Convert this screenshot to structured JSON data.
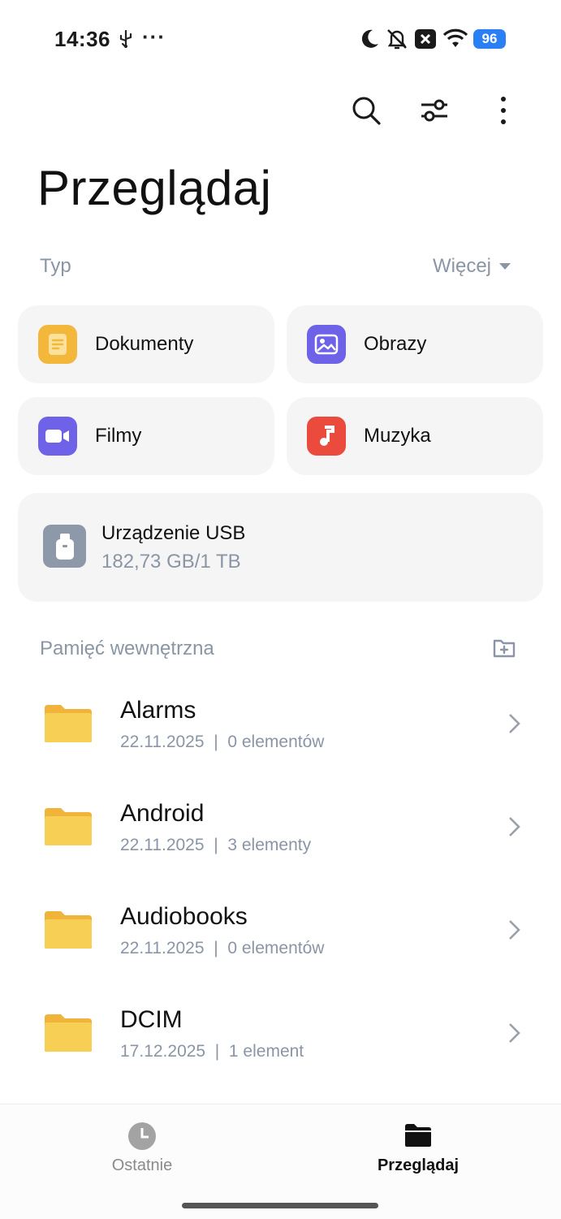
{
  "status_bar": {
    "time": "14:36",
    "dots": "···",
    "battery": "96",
    "icons": [
      "usb-icon",
      "moon-icon",
      "mute-icon",
      "close-notification-icon",
      "wifi-icon",
      "battery-icon"
    ]
  },
  "toolbar": {
    "icons": [
      "search-icon",
      "filter-icon",
      "more-vertical-icon"
    ]
  },
  "page_title": "Przeglądaj",
  "type_section": {
    "label": "Typ",
    "more_label": "Więcej",
    "items": [
      {
        "label": "Dokumenty",
        "icon": "document-icon",
        "color": "#f3b73c"
      },
      {
        "label": "Obrazy",
        "icon": "image-icon",
        "color": "#6e63e8"
      },
      {
        "label": "Filmy",
        "icon": "video-icon",
        "color": "#6e63e8"
      },
      {
        "label": "Muzyka",
        "icon": "music-icon",
        "color": "#eb4b3d"
      }
    ]
  },
  "usb": {
    "name": "Urządzenie USB",
    "size": "182,73 GB/1 TB"
  },
  "internal": {
    "label": "Pamięć wewnętrzna",
    "folders": [
      {
        "name": "Alarms",
        "date": "22.11.2025",
        "count": "0 elementów"
      },
      {
        "name": "Android",
        "date": "22.11.2025",
        "count": "3 elementy"
      },
      {
        "name": "Audiobooks",
        "date": "22.11.2025",
        "count": "0 elementów"
      },
      {
        "name": "DCIM",
        "date": "17.12.2025",
        "count": "1 element"
      }
    ],
    "separator": "|"
  },
  "bottom_nav": {
    "recent": "Ostatnie",
    "browse": "Przeglądaj"
  },
  "colors": {
    "folder": "#f6c94a",
    "muted_text": "#8a95a5",
    "accent_blue": "#2b7ff5"
  }
}
